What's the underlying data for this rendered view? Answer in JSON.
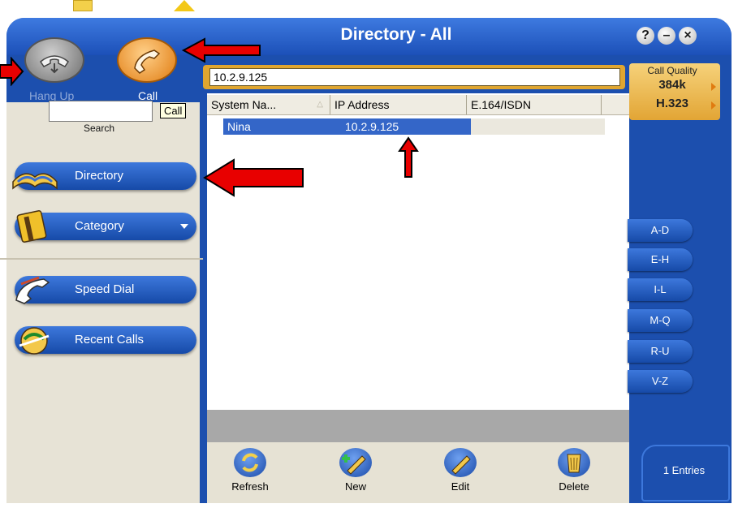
{
  "window": {
    "title": "Directory - All",
    "controls": [
      "?",
      "–",
      "×"
    ]
  },
  "phone": {
    "hang_up_label": "Hang Up",
    "call_label": "Call",
    "tooltip": "Call"
  },
  "search": {
    "value": "",
    "label": "Search"
  },
  "nav": {
    "directory": "Directory",
    "category": "Category",
    "speed_dial": "Speed Dial",
    "recent_calls": "Recent Calls"
  },
  "address_field": {
    "value": "10.2.9.125"
  },
  "table": {
    "columns": [
      "System Na...",
      "IP Address",
      "E.164/ISDN"
    ],
    "rows": [
      {
        "name": "Nina",
        "ip": "10.2.9.125",
        "e164": ""
      }
    ]
  },
  "call_quality": {
    "title": "Call Quality",
    "rate": "384k",
    "protocol": "H.323"
  },
  "alpha_filters": [
    "A-D",
    "E-H",
    "I-L",
    "M-Q",
    "R-U",
    "V-Z"
  ],
  "toolbar": {
    "refresh": "Refresh",
    "new": "New",
    "edit": "Edit",
    "delete": "Delete"
  },
  "status": {
    "entries": "1 Entries"
  },
  "colors": {
    "window_blue": "#1c4fae",
    "selection_blue": "#3466c8",
    "call_orange": "#e07b10",
    "annotation_red": "#e80000"
  }
}
